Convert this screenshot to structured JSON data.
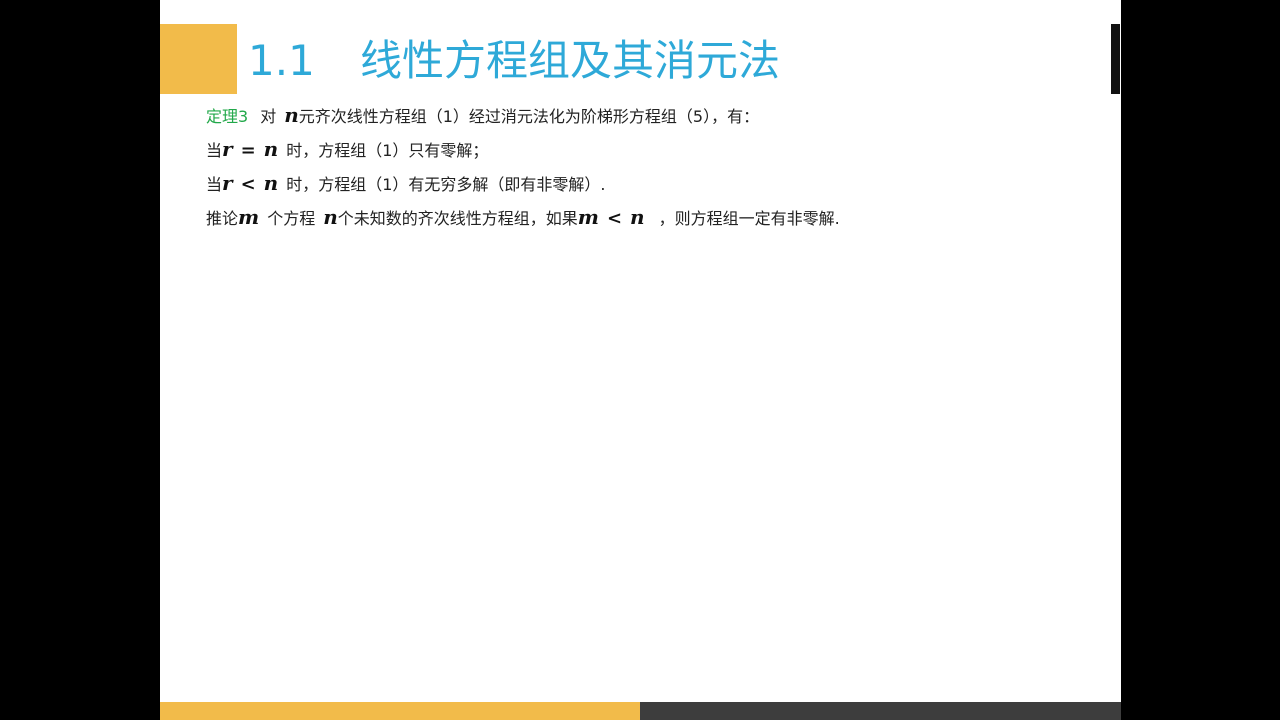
{
  "colors": {
    "accent_orange": "#F2BB4A",
    "title_blue": "#2EA9D8",
    "label_green": "#22A84A",
    "bar_dark": "#3D3D3D"
  },
  "slide": {
    "title_number": "1.1",
    "title_text": "线性方程组及其消元法"
  },
  "theorem": {
    "label": "定理3",
    "line1": {
      "prefix": "对",
      "var": "n",
      "text": "元齐次线性方程组（1）经过消元法化为阶梯形方程组（5），有："
    },
    "line2": {
      "prefix": "当",
      "lhs": "r",
      "op": "=",
      "rhs": "n",
      "text": "时，方程组（1）只有零解；"
    },
    "line3": {
      "prefix": "当",
      "lhs": "r",
      "op": "<",
      "rhs": "n",
      "text": "时，方程组（1）有无穷多解（即有非零解）."
    },
    "corollary": {
      "prefix": "推论",
      "var_m": "m",
      "text_a": "个方程",
      "var_n": "n",
      "text_b": "个未知数的齐次线性方程组，如果",
      "cond_lhs": "m",
      "cond_op": "<",
      "cond_rhs": "n",
      "text_c": "，则方程组一定有非零解."
    }
  }
}
